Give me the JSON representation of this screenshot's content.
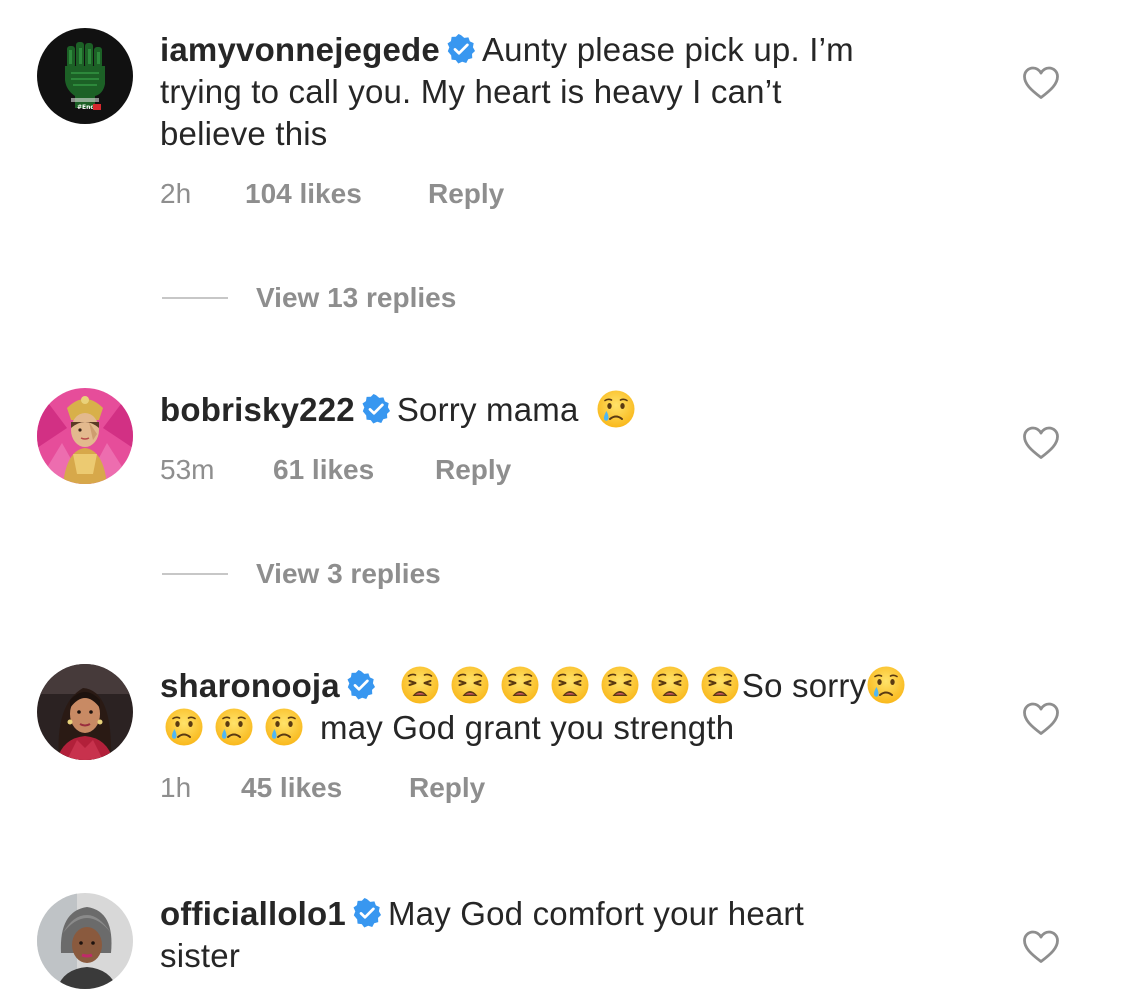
{
  "comments": [
    {
      "username": "iamyvonnejegede",
      "text_line1": "Aunty please pick up. I’m",
      "text_line2": "trying to call you. My heart is heavy I can’t",
      "text_line3": "believe this",
      "time": "2h",
      "likes": "104 likes",
      "reply": "Reply",
      "view_replies": "View 13 replies",
      "avatar_badge": "#End"
    },
    {
      "username": "bobrisky222",
      "text": "Sorry mama",
      "emoji": "crying-face",
      "time": "53m",
      "likes": "61 likes",
      "reply": "Reply",
      "view_replies": "View 3 replies"
    },
    {
      "username": "sharonooja",
      "text_line1": "So sorry",
      "text_line2": "may God grant you strength",
      "emojis_line1": [
        "weary-face",
        "weary-face",
        "weary-face",
        "weary-face",
        "weary-face",
        "weary-face",
        "weary-face"
      ],
      "emojis_line2": [
        "crying-face",
        "crying-face",
        "crying-face"
      ],
      "time": "1h",
      "likes": "45 likes",
      "reply": "Reply"
    },
    {
      "username": "officiallolo1",
      "text_line1": "May God comfort your heart",
      "text_line2": "sister"
    }
  ],
  "icons": {
    "verified": "verified-badge-icon",
    "like": "heart-outline-icon"
  },
  "colors": {
    "verified_blue": "#3897f0",
    "meta_gray": "#8e8e8e",
    "text": "#262626"
  }
}
